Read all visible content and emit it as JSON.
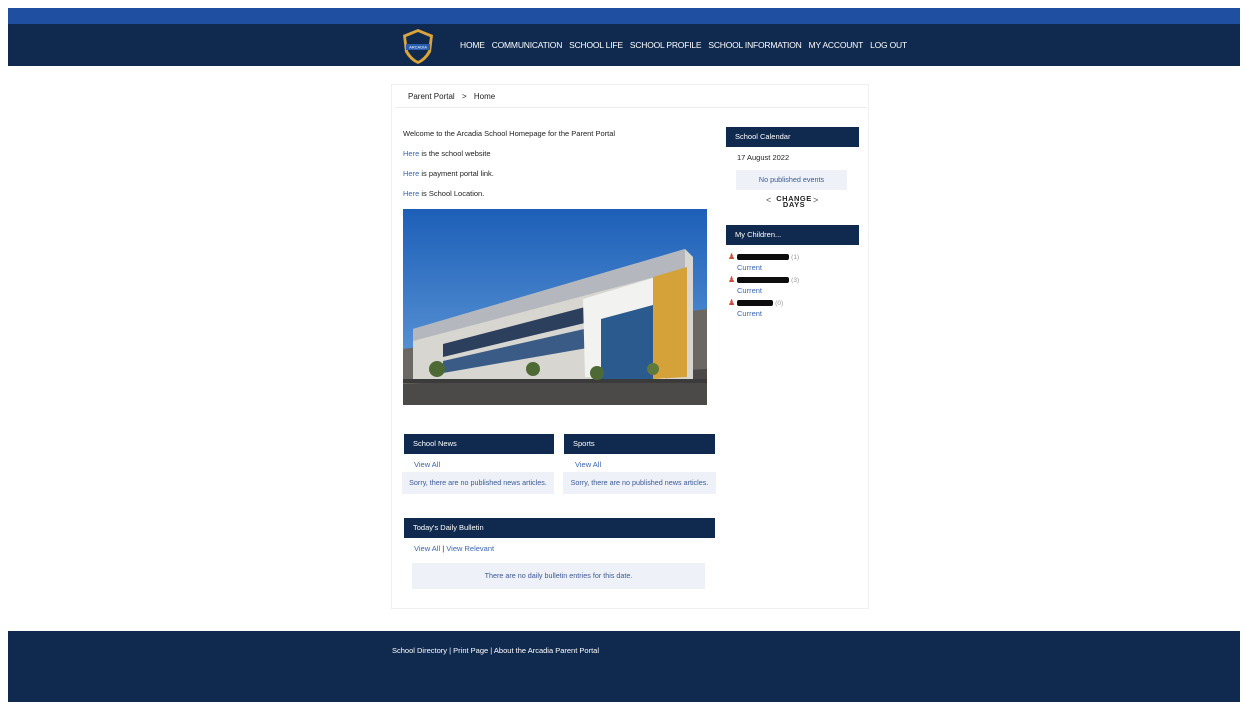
{
  "nav": {
    "items": [
      "HOME",
      "COMMUNICATION",
      "SCHOOL LIFE",
      "SCHOOL PROFILE",
      "SCHOOL INFORMATION",
      "MY ACCOUNT",
      "LOG OUT"
    ]
  },
  "breadcrumb": {
    "root": "Parent Portal",
    "separator": ">",
    "current": "Home"
  },
  "intro": {
    "welcome": "Welcome to the Arcadia School Homepage for the Parent Portal",
    "link_word": "Here",
    "line1_rest": " is the school website",
    "line2_rest": " is payment portal link.",
    "line3_rest": " is School Location."
  },
  "news": {
    "title": "School News",
    "view_all": "View All",
    "empty": "Sorry, there are no published news articles."
  },
  "sports": {
    "title": "Sports",
    "view_all": "View All",
    "empty": "Sorry, there are no published news articles."
  },
  "bulletin": {
    "title": "Today's Daily Bulletin",
    "view_all": "View All",
    "divider": "|",
    "view_relevant": "View Relevant",
    "empty": "There are no daily bulletin entries for this date."
  },
  "calendar": {
    "title": "School Calendar",
    "date": "17 August 2022",
    "empty": "No published events",
    "prev": "<",
    "next": ">",
    "change_label": "CHANGE",
    "days_label": "DAYS"
  },
  "children": {
    "title": "My Children...",
    "list": [
      {
        "grade": "(1)",
        "status": "Current"
      },
      {
        "grade": "(3)",
        "status": "Current"
      },
      {
        "grade": "(0)",
        "status": "Current"
      }
    ]
  },
  "footer": {
    "directory": "School Directory",
    "print": "Print Page",
    "about": "About the Arcadia Parent Portal",
    "divider": "|"
  },
  "logo": {
    "text": "ARCADIA"
  },
  "colors": {
    "header": "#10294f",
    "stripe": "#1f4fa0",
    "link": "#3b66b0",
    "gold": "#d9a43a"
  }
}
